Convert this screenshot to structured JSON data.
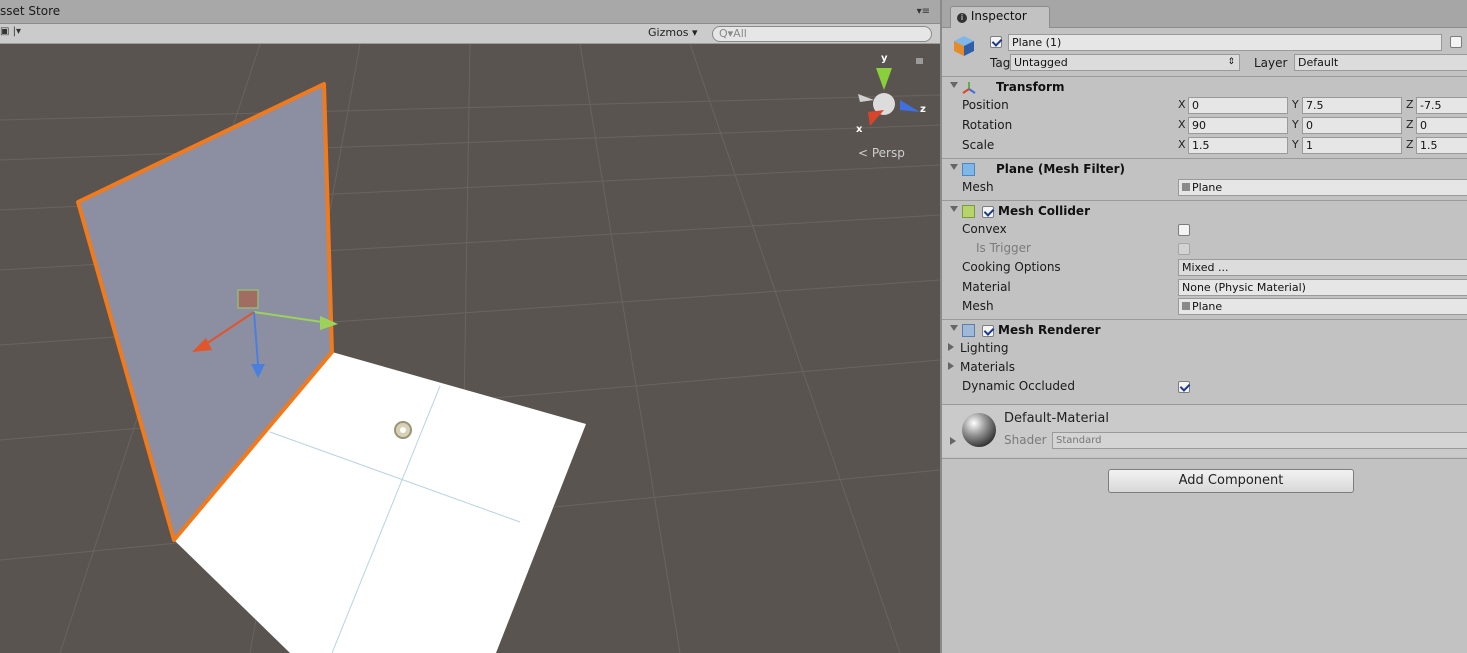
{
  "scene": {
    "tab_label": "sset Store",
    "gizmos_label": "Gizmos ▾",
    "search_placeholder": "Q▾All",
    "persp_label": "< Persp",
    "gizmo_axes": {
      "y": "y",
      "z": "z",
      "x": "x"
    }
  },
  "inspector": {
    "tab_label": "Inspector",
    "object_name": "Plane (1)",
    "tag_label": "Tag",
    "tag_value": "Untagged",
    "layer_label": "Layer",
    "layer_value": "Default",
    "transform": {
      "title": "Transform",
      "position_label": "Position",
      "position": {
        "x": "0",
        "y": "7.5",
        "z": "-7.5"
      },
      "rotation_label": "Rotation",
      "rotation": {
        "x": "90",
        "y": "0",
        "z": "0"
      },
      "scale_label": "Scale",
      "scale": {
        "x": "1.5",
        "y": "1",
        "z": "1.5"
      }
    },
    "mesh_filter": {
      "title": "Plane (Mesh Filter)",
      "mesh_label": "Mesh",
      "mesh_value": "Plane"
    },
    "mesh_collider": {
      "title": "Mesh Collider",
      "convex_label": "Convex",
      "is_trigger_label": "Is Trigger",
      "cooking_label": "Cooking Options",
      "cooking_value": "Mixed ...",
      "material_label": "Material",
      "material_value": "None (Physic Material)",
      "mesh_label": "Mesh",
      "mesh_value": "Plane"
    },
    "mesh_renderer": {
      "title": "Mesh Renderer",
      "lighting_label": "Lighting",
      "materials_label": "Materials",
      "dynamic_occluded_label": "Dynamic Occluded"
    },
    "material": {
      "name": "Default-Material",
      "shader_label": "Shader",
      "shader_value": "Standard"
    },
    "add_component_label": "Add Component"
  }
}
